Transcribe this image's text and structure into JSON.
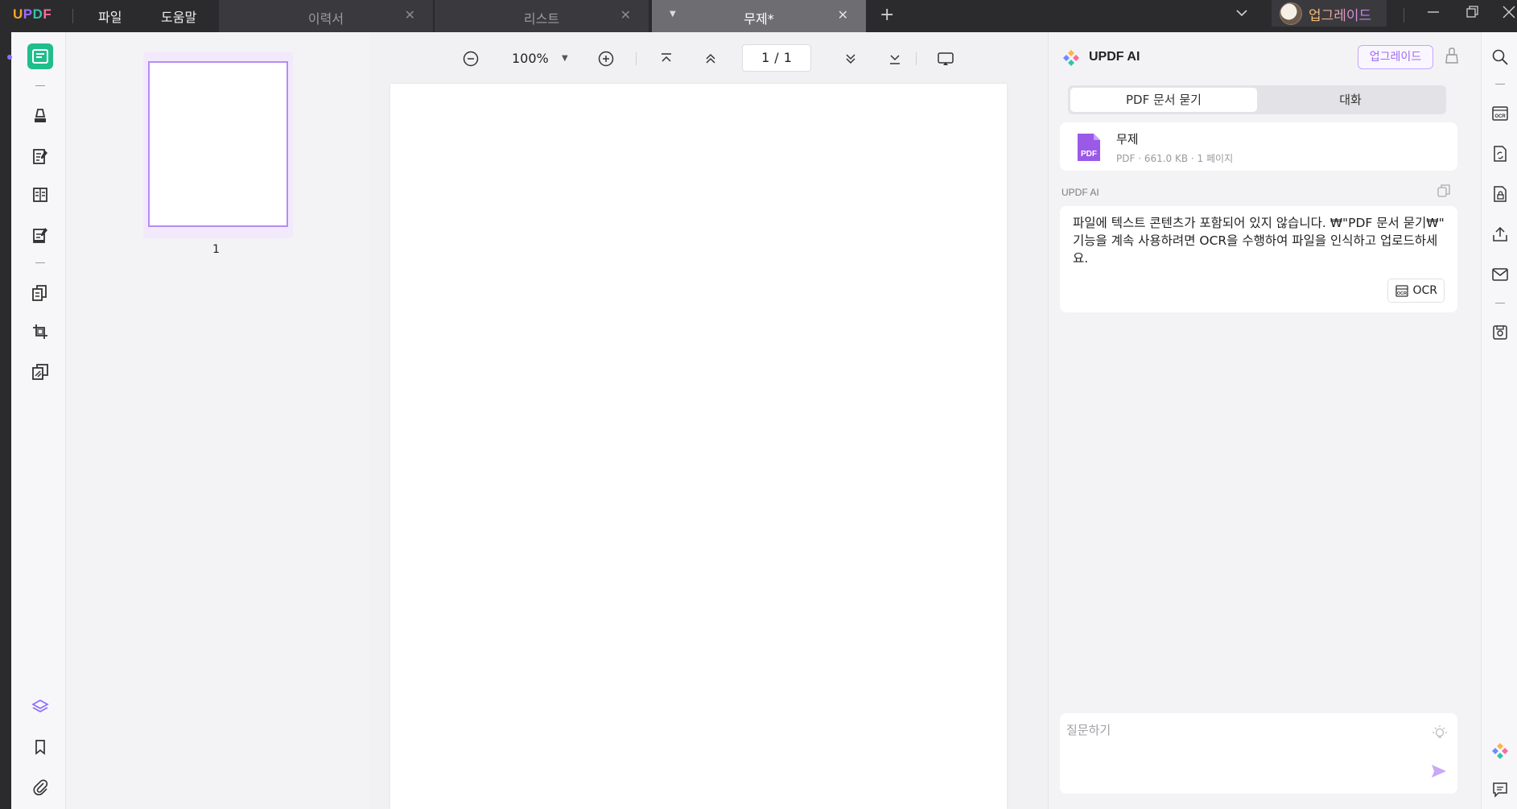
{
  "app": {
    "logo": {
      "u": "U",
      "p": "P",
      "d": "D",
      "f": "F"
    },
    "menu": [
      "파일",
      "도움말"
    ],
    "tabs": [
      {
        "label": "이력서",
        "active": false
      },
      {
        "label": "리스트",
        "active": false
      },
      {
        "label": "무제*",
        "active": true
      }
    ],
    "new_tab_symbol": "+",
    "upgrade_label": "업그레이드",
    "window_controls": [
      "minimize-icon",
      "restore-icon",
      "close-icon"
    ]
  },
  "viewer": {
    "zoom": "100%",
    "page_current": "1",
    "page_separator": "/",
    "page_total": "1"
  },
  "thumbnails": {
    "items": [
      {
        "number": "1"
      }
    ]
  },
  "ai": {
    "title": "UPDF AI",
    "upgrade_label": "업그레이드",
    "tabs": [
      "PDF 문서 묻기",
      "대화"
    ],
    "file": {
      "name": "무제",
      "meta": "PDF · 661.0 KB · 1 페이지"
    },
    "message_label": "UPDF AI",
    "message": "파일에 텍스트 콘텐츠가 포함되어 있지 않습니다. ₩\"PDF 문서 묻기₩\" 기능을 계속 사용하려면 OCR을 수행하여 파일을 인식하고 업로드하세요.",
    "ocr_label": "OCR",
    "ask_placeholder": "질문하기"
  },
  "colors": {
    "accent_green": "#1fbe8a",
    "accent_purple": "#9e6cf0",
    "titlebar": "#2b2b2e"
  },
  "icons": {
    "left_rail": [
      "reader-icon",
      "highlight-icon",
      "edit-text-icon",
      "form-icon",
      "fill-sign-icon",
      "organize-pages-icon",
      "crop-icon",
      "protect-icon",
      "layers-icon",
      "bookmark-icon",
      "attachment-icon"
    ],
    "toolbar": [
      "zoom-out-icon",
      "zoom-in-icon",
      "first-page-icon",
      "prev-page-icon",
      "next-page-icon",
      "last-page-icon",
      "presentation-icon"
    ],
    "right_rail": [
      "search-icon",
      "ocr-icon",
      "convert-icon",
      "protect-file-icon",
      "share-icon",
      "email-icon",
      "save-icon",
      "updf-ai-icon",
      "comment-icon"
    ]
  }
}
